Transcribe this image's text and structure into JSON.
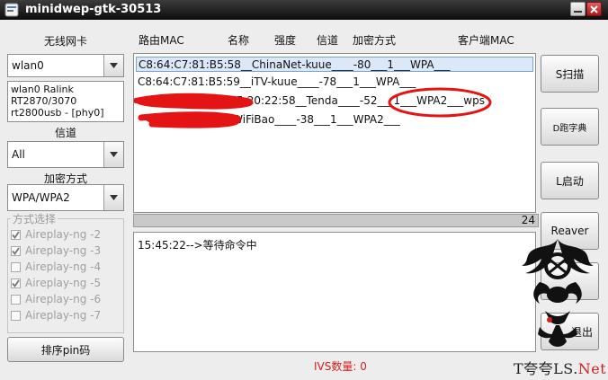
{
  "window": {
    "title": "minidwep-gtk-30513"
  },
  "left": {
    "wireless_label": "无线网卡",
    "interface_value": "wlan0",
    "chipset_lines": [
      "wlan0 Ralink",
      "RT2870/3070",
      "rt2800usb - [phy0]"
    ],
    "channel_label": "信道",
    "channel_value": "All",
    "encryption_label": "加密方式",
    "encryption_value": "WPA/WPA2",
    "mode_group_label": "方式选择",
    "modes": [
      {
        "label": "Aireplay-ng -2",
        "checked": true
      },
      {
        "label": "Aireplay-ng -3",
        "checked": true
      },
      {
        "label": "Aireplay-ng -4",
        "checked": false
      },
      {
        "label": "Aireplay-ng -5",
        "checked": true
      },
      {
        "label": "Aireplay-ng -6",
        "checked": false
      },
      {
        "label": "Aireplay-ng -7",
        "checked": false
      }
    ],
    "sort_pin_label": "排序pin码"
  },
  "columns": {
    "mac": "路由MAC",
    "name": "名称",
    "strength": "强度",
    "channel": "信道",
    "encryption": "加密方式",
    "client_mac": "客户端MAC"
  },
  "networks": [
    "C8:64:C7:81:B5:58__ChinaNet-kuue____-80___1___WPA___",
    "C8:64:C7:81:B5:59__iTV-kuue____-78___1___WPA___",
    ":5:20:22:58__Tenda____-52___1___WPA2___wps",
    "E__AWiFiBao____-38___1___WPA2___"
  ],
  "progress_value": "24",
  "log_text": "15:45:22-->等待命令中",
  "ivs_text": "IVS数量: 0",
  "buttons": {
    "scan": "S扫描",
    "dict": "D跑字典",
    "start": "L启动",
    "reaver": "Reaver",
    "exit": "退出"
  },
  "brand": {
    "prefix": "T",
    "middle": "夸夸LS.",
    "suffix": "Net"
  },
  "colors": {
    "selected_row": "#dbe8f8",
    "scribble": "#e41414",
    "ivs_text": "#d42020"
  }
}
